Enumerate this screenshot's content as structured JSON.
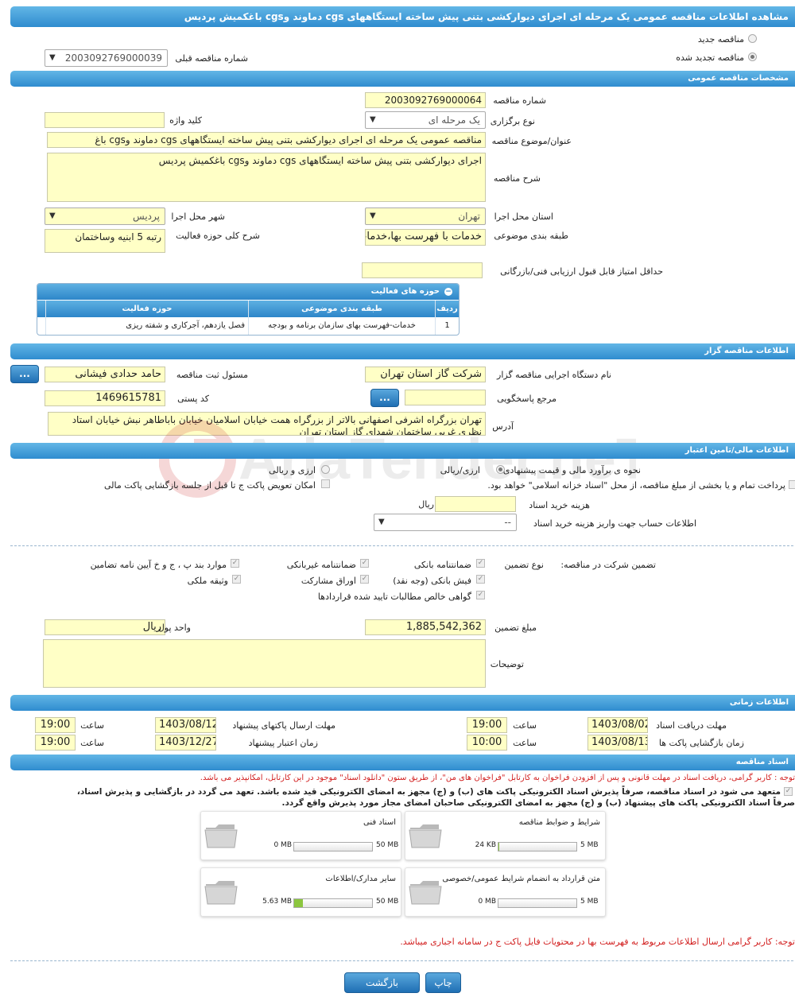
{
  "header": {
    "title": "مشاهده اطلاعات مناقصه عمومی یک مرحله ای اجرای دیوارکشی بتنی پیش ساخته ایستگاههای cgs دماوند وcgs باغکمیش پردیس"
  },
  "tender_type": {
    "new_label": "مناقصه جدید",
    "renewed_label": "مناقصه تجدید شده",
    "prev_number_label": "شماره مناقصه قبلی",
    "prev_number_value": "2003092769000039"
  },
  "general": {
    "section_title": "مشخصات مناقصه عمومی",
    "number_label": "شماره مناقصه",
    "number_value": "2003092769000064",
    "holding_type_label": "نوع برگزاری",
    "holding_type_value": "یک مرحله ای",
    "keyword_label": "کلید واژه",
    "keyword_value": "",
    "subject_label": "عنوان/موضوع مناقصه",
    "subject_value": "مناقصه عمومی یک مرحله ای اجرای دیوارکشی بتنی پیش ساخته ایستگاههای cgs  دماوند وcgs باغ",
    "desc_label": "شرح مناقصه",
    "desc_value": "اجرای دیوارکشی بتنی پیش ساخته ایستگاههای cgs  دماوند وcgs باغکمیش پردیس",
    "province_label": "استان محل اجرا",
    "province_value": "تهران",
    "city_label": "شهر محل اجرا",
    "city_value": "پردیس",
    "category_label": "طبقه بندی موضوعی",
    "category_value": "خدمات با فهرست بها،خدمات",
    "activity_label": "شرح کلی حوزه فعالیت",
    "activity_value": "رتبه 5 ابنیه وساختمان",
    "min_score_label": "حداقل امتیاز قابل قبول ارزیابی فنی/بازرگانی",
    "min_score_value": ""
  },
  "activities": {
    "title": "حوزه های فعالیت",
    "headers": [
      "ردیف",
      "طبقه بندی موضوعی",
      "حوزه فعالیت"
    ],
    "rows": [
      [
        "1",
        "خدمات-فهرست بهای سازمان برنامه و بودجه",
        "فصل یازدهم، آجرکاری و شفته ریزی"
      ]
    ]
  },
  "organizer": {
    "section_title": "اطلاعات مناقصه گزار",
    "org_label": "نام دستگاه اجرایی مناقصه گزار",
    "org_value": "شرکت گاز استان تهران",
    "officer_label": "مسئول ثبت مناقصه",
    "officer_value": "حامد حدادی فیشانی",
    "ref_label": "مرجع پاسخگویی",
    "ref_value": "",
    "postal_label": "کد پستی",
    "postal_value": "1469615781",
    "address_label": "آدرس",
    "address_value": "تهران بزرگراه اشرفی اصفهانی بالاتر از بزرگراه همت خیابان اسلامیان خیابان باباطاهر نبش خیابان استاد نظری غربی ساختمان شهدای گاز استان تهران",
    "dots_label": "..."
  },
  "finance": {
    "section_title": "اطلاعات مالی/تامین اعتبار",
    "estimate_label": "نحوه ی برآورد مالی و قیمت پیشنهادی",
    "opt_rial": "ارزی/ریالی",
    "opt_currency": "ارزی و ریالی",
    "treasury_text": "پرداخت تمام و یا بخشی از مبلغ مناقصه، از محل \"اسناد خزانه اسلامی\" خواهد بود.",
    "swap_text": "امکان تعویض پاکت ج تا قبل از جلسه بازگشایی پاکت مالی",
    "doc_cost_label": "هزینه خرید اسناد",
    "doc_cost_value": "",
    "doc_cost_unit": "ریال",
    "account_label": "اطلاعات حساب جهت واریز هزینه خرید اسناد",
    "account_value": "--"
  },
  "guarantee": {
    "participation_label": "تضمین شرکت در مناقصه:",
    "type_label": "نوع تضمین",
    "items": [
      "ضمانتنامه بانکی",
      "ضمانتنامه غیربانکی",
      "موارد بند پ ، ج و خ آیین نامه تضامین",
      "فیش بانکی (وجه نقد)",
      "اوراق مشارکت",
      "وثیقه ملکی",
      "گواهی خالص مطالبات تایید شده قراردادها"
    ],
    "amount_label": "مبلغ تضمین",
    "amount_value": "1,885,542,362",
    "currency_label": "واحد پول",
    "currency_value": "ریال",
    "notes_label": "توضیحات",
    "notes_value": ""
  },
  "timing": {
    "section_title": "اطلاعات زمانی",
    "receive_label": "مهلت دریافت اسناد",
    "receive_date": "1403/08/02",
    "receive_time": "19:00",
    "send_label": "مهلت ارسال پاکتهای پیشنهاد",
    "send_date": "1403/08/12",
    "send_time": "19:00",
    "open_label": "زمان بازگشایی پاکت ها",
    "open_date": "1403/08/13",
    "open_time": "10:00",
    "valid_label": "زمان اعتبار پیشنهاد",
    "valid_date": "1403/12/27",
    "valid_time": "19:00",
    "time_label": "ساعت"
  },
  "documents": {
    "section_title": "اسناد مناقصه",
    "notice": "توجه : کاربر گرامی، دریافت اسناد در مهلت قانونی و پس از افزودن فراخوان به کارتابل \"فراخوان های من\"، از طریق ستون \"دانلود اسناد\" موجود در این کارتابل، امکانپذیر می باشد.",
    "commit_line1": "متعهد می شود در اسناد مناقصه، صرفاً پذیرش اسناد الکترونیکی پاکت های (ب) و (ج) مجهز به امضای الکترونیکی قید شده باشد. تعهد می گردد در بازگشایی و پذیرش اسناد،",
    "commit_line2": "صرفاً اسناد الکترونیکی پاکت های پیشنهاد (ب) و (ج) مجهز به امضای الکترونیکی صاحبان امضای مجاز مورد پذیرش واقع گردد.",
    "cards": [
      {
        "title": "شرایط و ضوابط مناقصه",
        "used": "24 KB",
        "max": "5 MB",
        "fill": 0.005
      },
      {
        "title": "اسناد فنی",
        "used": "0 MB",
        "max": "50 MB",
        "fill": 0
      },
      {
        "title": "متن قرارداد به انضمام شرایط عمومی/خصوصی",
        "used": "0 MB",
        "max": "5 MB",
        "fill": 0
      },
      {
        "title": "سایر مدارک/اطلاعات",
        "used": "5.63 MB",
        "max": "50 MB",
        "fill": 0.113
      }
    ],
    "bottom_notice": "توجه: کاربر گرامی ارسال اطلاعات مربوط به فهرست بها در محتویات فایل پاکت ج در سامانه اجباری میباشد."
  },
  "actions": {
    "print": "چاپ",
    "back": "بازگشت"
  },
  "watermark": {
    "text": "AriaTender.neT"
  },
  "colors": {
    "band": "#2f8ccf",
    "field": "#ffffc6",
    "alert": "#d21f1f"
  }
}
